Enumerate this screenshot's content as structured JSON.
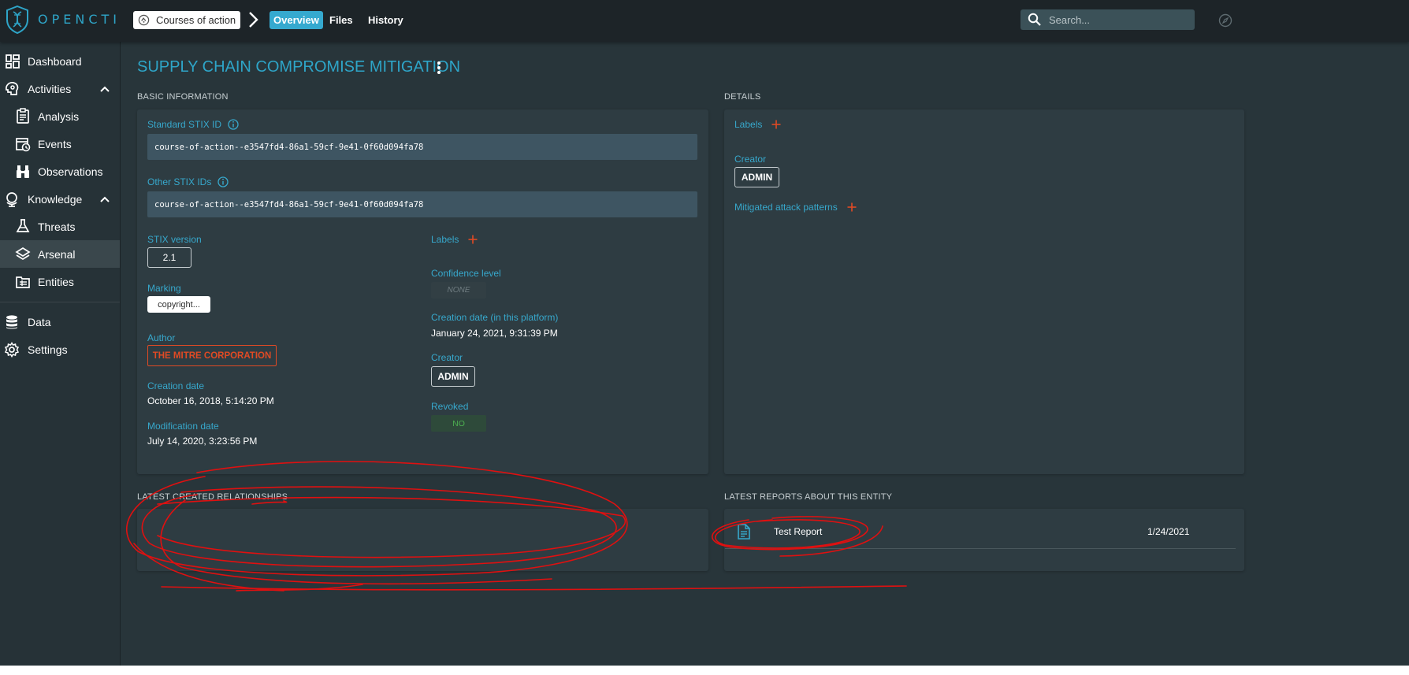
{
  "app": {
    "logo_text": "OPENCTI",
    "breadcrumb": "Courses of action",
    "tabs": [
      {
        "label": "Overview",
        "active": true
      },
      {
        "label": "Files",
        "active": false
      },
      {
        "label": "History",
        "active": false
      }
    ],
    "search_placeholder": "Search...",
    "accent_color": "#2ea5c8",
    "danger_color": "#e04a24"
  },
  "sidebar": {
    "items": [
      {
        "label": "Dashboard",
        "icon": "dashboard-icon"
      },
      {
        "label": "Activities",
        "icon": "activities-icon",
        "expanded": true
      },
      {
        "label": "Analysis",
        "icon": "analysis-icon"
      },
      {
        "label": "Events",
        "icon": "events-icon"
      },
      {
        "label": "Observations",
        "icon": "observations-icon"
      },
      {
        "label": "Knowledge",
        "icon": "knowledge-icon",
        "expanded": true
      },
      {
        "label": "Threats",
        "icon": "threats-icon"
      },
      {
        "label": "Arsenal",
        "icon": "arsenal-icon",
        "active": true
      },
      {
        "label": "Entities",
        "icon": "entities-icon"
      },
      {
        "label": "Data",
        "icon": "data-icon"
      },
      {
        "label": "Settings",
        "icon": "settings-icon"
      }
    ]
  },
  "entity": {
    "title": "SUPPLY CHAIN COMPROMISE MITIGATION"
  },
  "basic": {
    "section_title": "BASIC INFORMATION",
    "standard_stix_label": "Standard STIX ID",
    "standard_stix_value": "course-of-action--e3547fd4-86a1-59cf-9e41-0f60d094fa78",
    "other_stix_label": "Other STIX IDs",
    "other_stix_value": "course-of-action--e3547fd4-86a1-59cf-9e41-0f60d094fa78",
    "stix_version_label": "STIX version",
    "stix_version_value": "2.1",
    "marking_label": "Marking",
    "marking_value": "copyright...",
    "author_label": "Author",
    "author_value": "THE MITRE CORPORATION",
    "creation_date_label": "Creation date",
    "creation_date_value": "October 16, 2018, 5:14:20 PM",
    "modification_date_label": "Modification date",
    "modification_date_value": "July 14, 2020, 3:23:56 PM",
    "labels_label": "Labels",
    "confidence_label": "Confidence level",
    "confidence_value": "NONE",
    "platform_date_label": "Creation date (in this platform)",
    "platform_date_value": "January 24, 2021, 9:31:39 PM",
    "creator_label": "Creator",
    "creator_value": "ADMIN",
    "revoked_label": "Revoked",
    "revoked_value": "NO"
  },
  "details": {
    "section_title": "DETAILS",
    "labels_label": "Labels",
    "creator_label": "Creator",
    "creator_value": "ADMIN",
    "mitigated_label": "Mitigated attack patterns"
  },
  "relationships": {
    "section_title": "LATEST CREATED RELATIONSHIPS"
  },
  "reports": {
    "section_title": "LATEST REPORTS ABOUT THIS ENTITY",
    "items": [
      {
        "name": "Test Report",
        "date": "1/24/2021"
      }
    ]
  }
}
